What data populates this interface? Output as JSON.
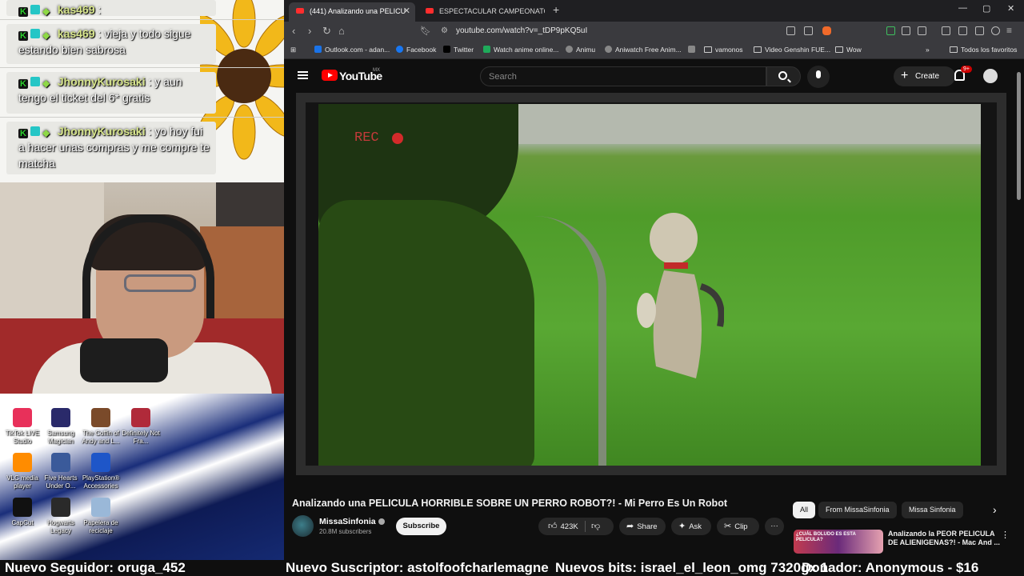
{
  "chat": {
    "messages": [
      {
        "user": "kas469",
        "text": ""
      },
      {
        "user": "kas469",
        "text": "vieja y todo sigue estando bien sabrosa"
      },
      {
        "user": "JhonnyKurosaki",
        "text": "y aun tengo el ticket del 6* gratis"
      },
      {
        "user": "JhonnyKurosaki",
        "text": "yo hoy fui a hacer unas compras y me compre te matcha"
      }
    ]
  },
  "desktop_icons": [
    {
      "label": "TikTok LIVE Studio",
      "color": "#e8305a"
    },
    {
      "label": "Samsung Magician",
      "color": "#2a2a6a"
    },
    {
      "label": "The Coffin of Andy and L...",
      "color": "#7a4a2a"
    },
    {
      "label": "Definitely Not Fra...",
      "color": "#b02a3a"
    },
    {
      "label": "VLC media player",
      "color": "#ff8c00"
    },
    {
      "label": "Five Hearts Under O...",
      "color": "#3a5a9a"
    },
    {
      "label": "PlayStation® Accessories",
      "color": "#1e56c8"
    },
    {
      "label": "CapCut",
      "color": "#111111"
    },
    {
      "label": "Hogwarts Legacy",
      "color": "#2a2a2a"
    },
    {
      "label": "Papelera de reciclaje",
      "color": "#9ab8d8"
    }
  ],
  "stream_bar": {
    "follower": "Nuevo Seguidor: oruga_452",
    "subscriber": "Nuevo Suscriptor: astolfoofcharlemagne",
    "bits": "Nuevos bits: israel_el_leon_omg 7320gx 1",
    "donor": "Donador: Anonymous - $16"
  },
  "browser": {
    "tabs": [
      {
        "label": "(441) Analizando una PELICU",
        "active": true
      },
      {
        "label": "ESPECTACULAR CAMPEONATO MUN",
        "active": false
      }
    ],
    "url": "youtube.com/watch?v=_tDP9pKQ5uI",
    "bookmarks": [
      {
        "label": "Outlook.com - adan...",
        "color": "#1a73e8"
      },
      {
        "label": "Facebook",
        "color": "#1877f2"
      },
      {
        "label": "Twitter",
        "color": "#000000"
      },
      {
        "label": "Watch anime online...",
        "color": "#1faa5a"
      },
      {
        "label": "Animu",
        "color": "#888888"
      },
      {
        "label": "Aniwatch Free Anim...",
        "color": "#888888"
      },
      {
        "label": "vamonos",
        "color": "folder"
      },
      {
        "label": "Video Genshin FUE...",
        "color": "folder"
      },
      {
        "label": "Wow",
        "color": "folder"
      }
    ],
    "all_bookmarks": "Todos los favoritos"
  },
  "youtube": {
    "logo": "YouTube",
    "region": "MX",
    "search_placeholder": "Search",
    "create": "Create",
    "notifications": "9+",
    "video": {
      "rec_label": "REC",
      "title": "Analizando una PELICULA HORRIBLE SOBRE UN PERRO ROBOT?! - Mi Perro Es Un Robot",
      "channel": "MissaSinfonia",
      "subscribers": "20.8M subscribers",
      "subscribe": "Subscribe",
      "likes": "423K",
      "share": "Share",
      "ask": "Ask",
      "clip": "Clip"
    },
    "chips": [
      "All",
      "From MissaSinfonia",
      "Missa Sinfonia"
    ],
    "recommendation": {
      "title": "Analizando la PEOR PELICULA DE ALIENIGENAS?! - Mac And ...",
      "thumb_text": "¿CUÁL BOLUDO ES ESTA PELICULA?"
    }
  }
}
